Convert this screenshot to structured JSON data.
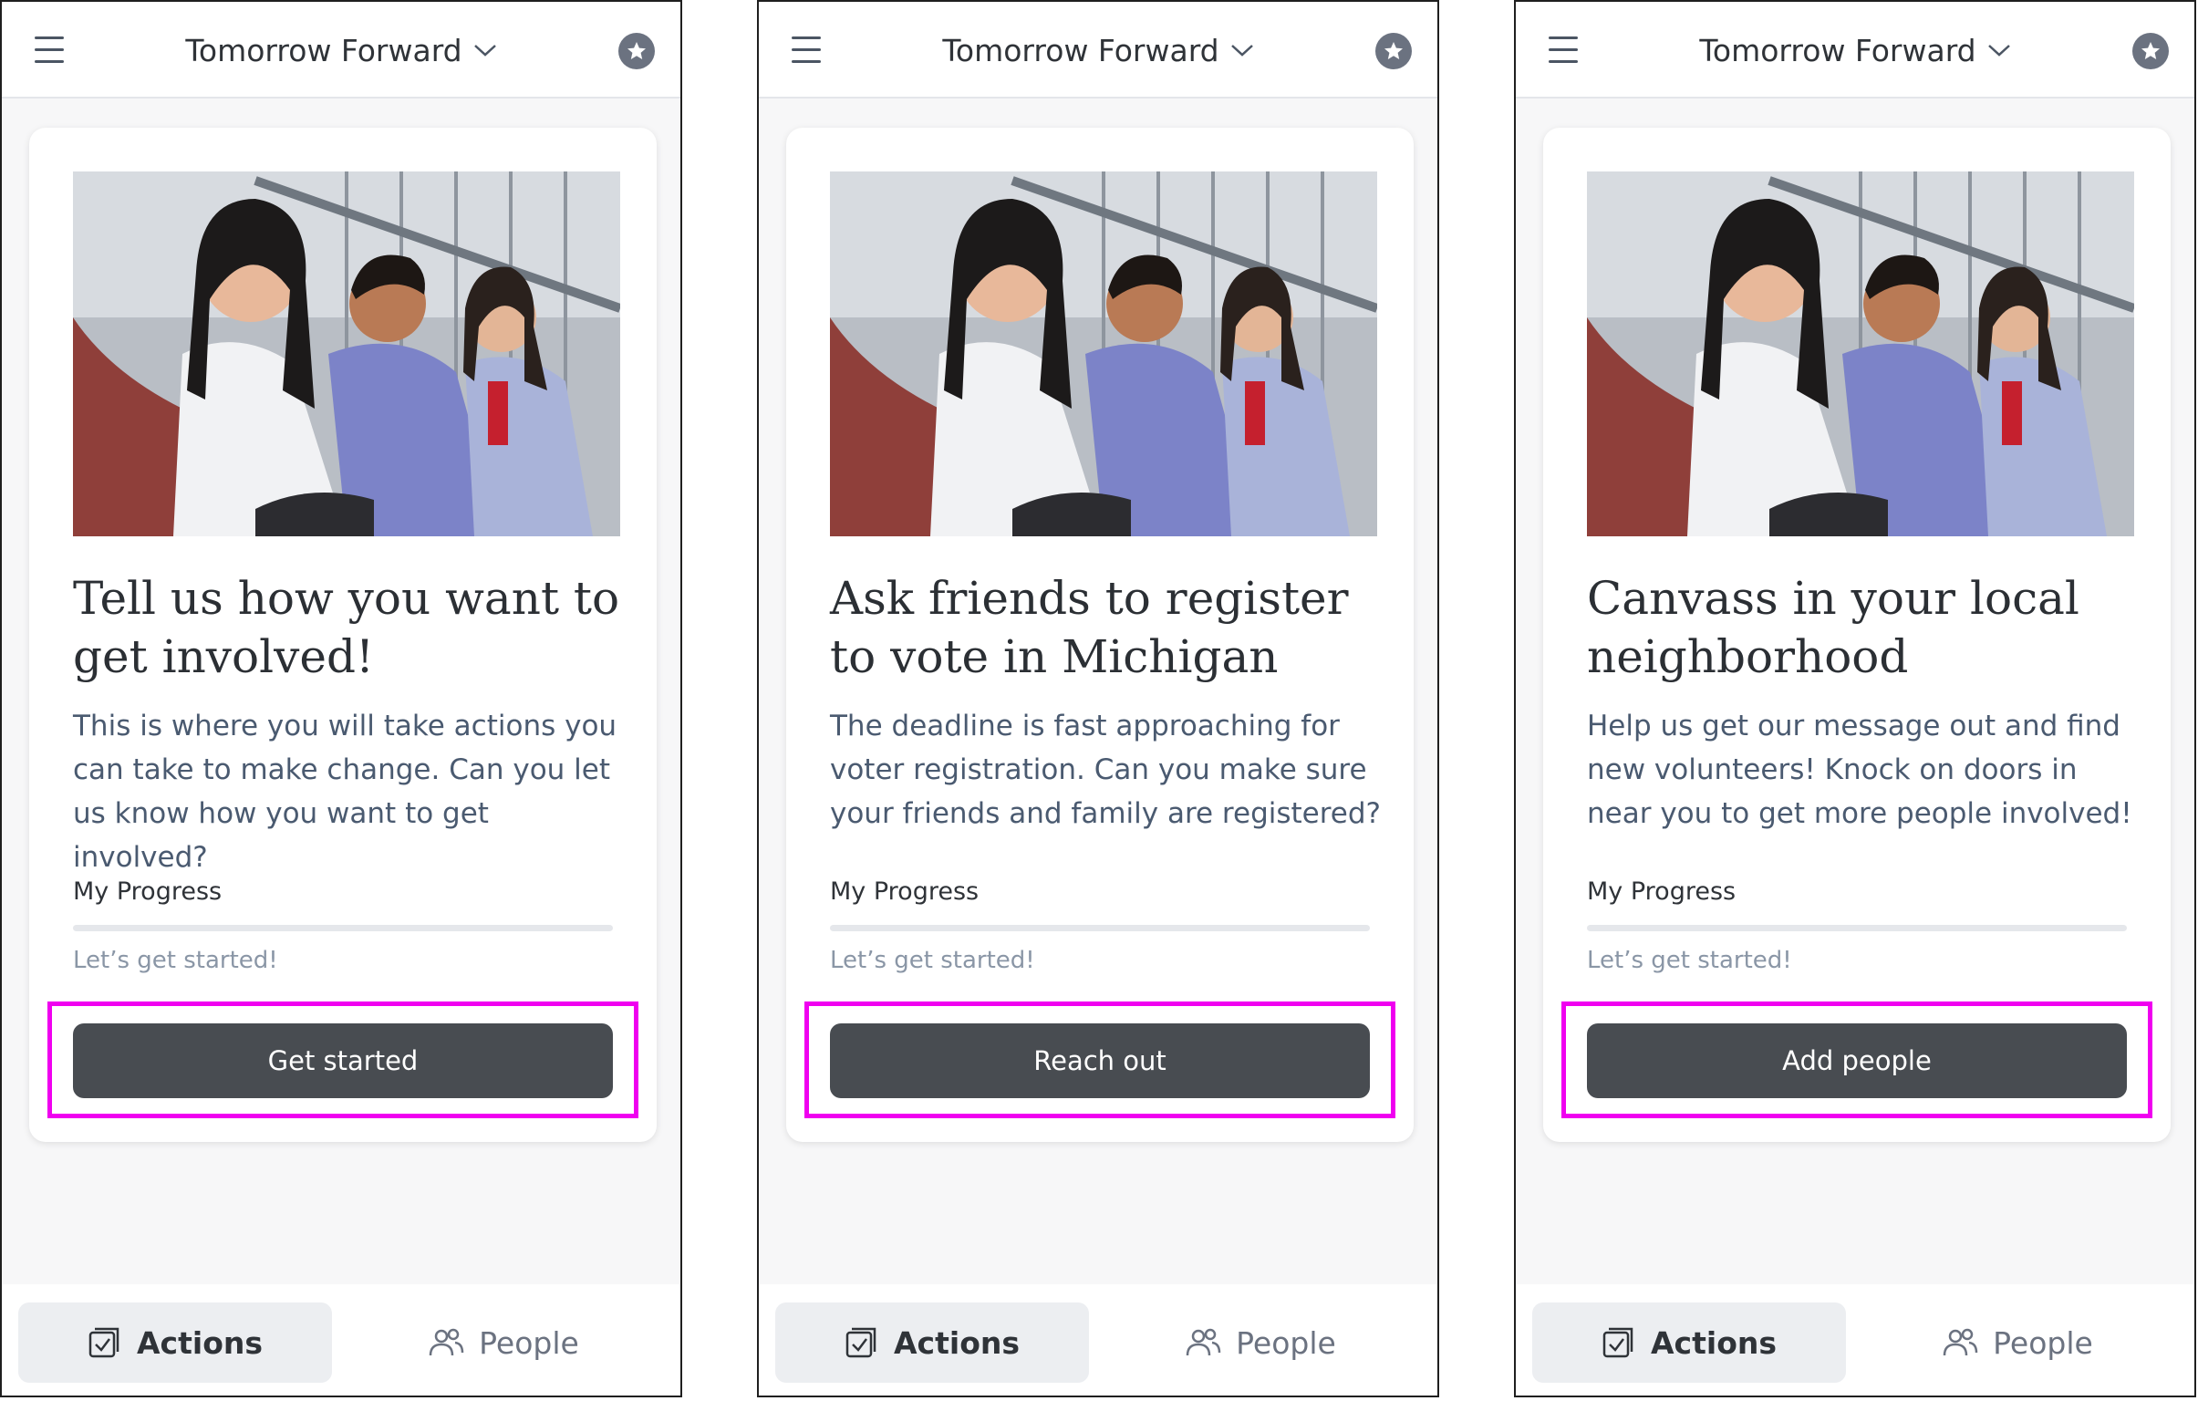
{
  "screens": [
    {
      "header": {
        "org_name": "Tomorrow Forward"
      },
      "card": {
        "title": "Tell us how you want to get involved!",
        "description": "This is where you will take actions you can take to make change. Can you let us know how you want to get involved?",
        "progress_label": "My Progress",
        "progress_value": 0,
        "progress_status": "Let’s get started!",
        "button_label": "Get started"
      },
      "nav": {
        "actions_label": "Actions",
        "people_label": "People"
      }
    },
    {
      "header": {
        "org_name": "Tomorrow Forward"
      },
      "card": {
        "title": "Ask friends to register to vote in Michigan",
        "description": "The deadline is fast approaching for voter registration. Can you make sure your friends and family are registered?",
        "progress_label": "My Progress",
        "progress_value": 0,
        "progress_status": "Let’s get started!",
        "button_label": "Reach out"
      },
      "nav": {
        "actions_label": "Actions",
        "people_label": "People"
      }
    },
    {
      "header": {
        "org_name": "Tomorrow Forward"
      },
      "card": {
        "title": "Canvass in your local neighborhood",
        "description": "Help us get our message out and find new volunteers! Knock on doors in near you to get more people involved!",
        "progress_label": "My Progress",
        "progress_value": 0,
        "progress_status": "Let’s get started!",
        "button_label": "Add people"
      },
      "nav": {
        "actions_label": "Actions",
        "people_label": "People"
      }
    }
  ],
  "colors": {
    "highlight": "#f000f0",
    "button": "#484c51",
    "active_tab": "#eceef1"
  },
  "icons": [
    "menu-icon",
    "chevron-down-icon",
    "star-icon",
    "actions-checkbox-icon",
    "people-icon"
  ]
}
